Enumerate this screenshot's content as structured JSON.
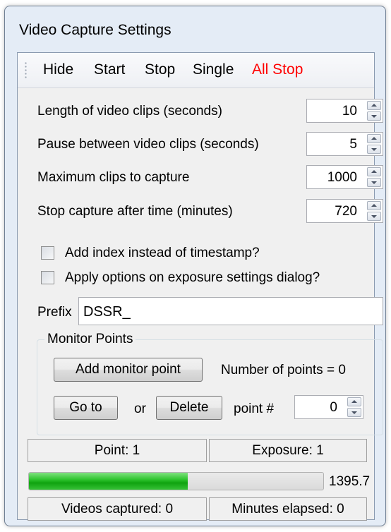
{
  "window": {
    "title": "Video Capture Settings"
  },
  "toolbar": {
    "hide": "Hide",
    "start": "Start",
    "stop": "Stop",
    "single": "Single",
    "all_stop": "All Stop",
    "all_stop_color": "#ff0000"
  },
  "settings": {
    "clip_length_label": "Length of video clips (seconds)",
    "clip_length_value": "10",
    "pause_label": "Pause between video clips (seconds)",
    "pause_value": "5",
    "max_clips_label": "Maximum clips to capture",
    "max_clips_value": "1000",
    "stop_after_label": "Stop capture after time (minutes)",
    "stop_after_value": "720"
  },
  "options": {
    "add_index_label": "Add index instead of timestamp?",
    "add_index_checked": false,
    "apply_options_label": "Apply options on exposure settings dialog?",
    "apply_options_checked": false
  },
  "prefix": {
    "label": "Prefix",
    "value": "DSSR_"
  },
  "monitor": {
    "group_label": "Monitor Points",
    "add_button": "Add monitor point",
    "count_text": "Number of points = 0",
    "goto_button": "Go to",
    "or_text": "or",
    "delete_button": "Delete",
    "point_label": "point #",
    "point_value": "0"
  },
  "status": {
    "point": "Point: 1",
    "exposure": "Exposure: 1",
    "progress_fraction": 0.54,
    "progress_text": "1395.7",
    "videos_captured": "Videos captured: 0",
    "minutes_elapsed": "Minutes elapsed: 0"
  }
}
